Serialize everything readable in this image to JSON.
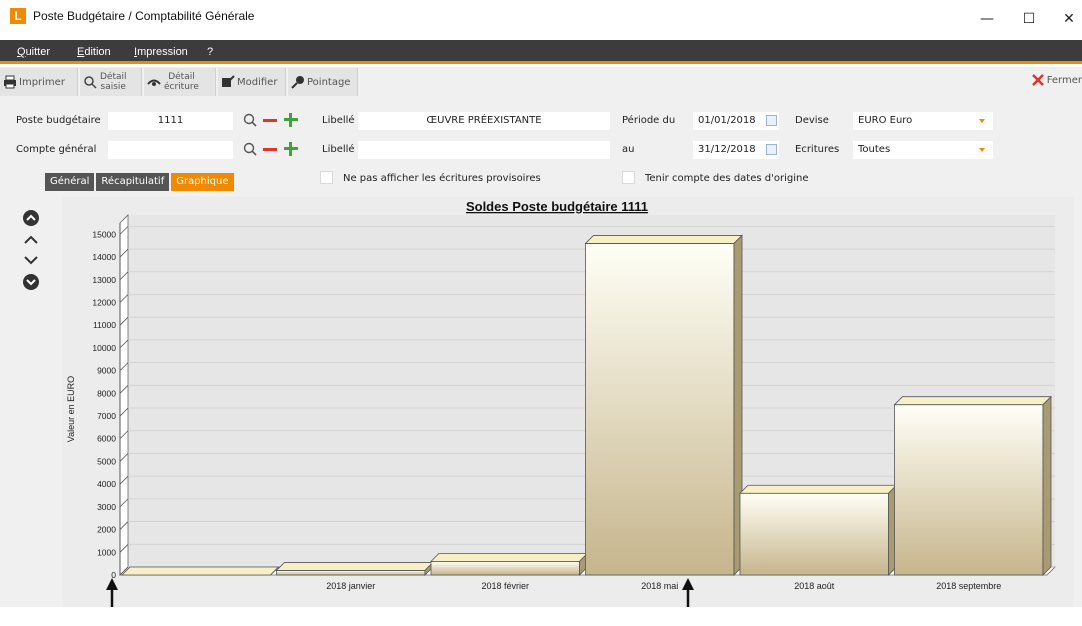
{
  "window": {
    "logo": "L",
    "title": "Poste Budgétaire / Comptabilité Générale",
    "minimize": "—",
    "maximize": "☐",
    "close": "✕"
  },
  "menu": [
    "Quitter",
    "Edition",
    "Impression",
    "?"
  ],
  "toolbar": {
    "imprimer": "Imprimer",
    "detail_saisie_1": "Détail",
    "detail_saisie_2": "saisie",
    "detail_ecriture_1": "Détail",
    "detail_ecriture_2": "écriture",
    "modifier": "Modifier",
    "pointage": "Pointage",
    "fermer": "Fermer"
  },
  "form": {
    "poste_label": "Poste budgétaire",
    "poste_value": "1111",
    "libelle1_label": "Libellé",
    "libelle1_value": "ŒUVRE PRÉEXISTANTE",
    "periode_label": "Période du",
    "date_from": "01/01/2018",
    "devise_label": "Devise",
    "devise_value": "EURO Euro",
    "compte_label": "Compte général",
    "compte_value": "",
    "libelle2_label": "Libellé",
    "libelle2_value": "",
    "au_label": "au",
    "date_to": "31/12/2018",
    "ecritures_label": "Ecritures",
    "ecritures_value": "Toutes",
    "chk1_label": "Ne pas afficher les écritures provisoires",
    "chk2_label": "Tenir compte des dates d'origine"
  },
  "tabs": [
    "Général",
    "Récapitulatif",
    "Graphique"
  ],
  "active_tab": "Graphique",
  "chart_data": {
    "type": "bar",
    "title": "Soldes Poste budgétaire 1111",
    "ylabel": "Valeur en EURO",
    "xlabel": "",
    "categories": [
      "",
      "2018 janvier",
      "2018 février",
      "2018 mai",
      "2018 août",
      "2018 septembre"
    ],
    "values": [
      0,
      200,
      600,
      14600,
      3600,
      7500
    ],
    "yticks": [
      0,
      1000,
      2000,
      3000,
      4000,
      5000,
      6000,
      7000,
      8000,
      9000,
      10000,
      11000,
      12000,
      13000,
      14000,
      15000
    ],
    "ylim": [
      0,
      15500
    ],
    "grid": true
  },
  "colors": {
    "accent": "#f08a00",
    "menubar": "#3c3c3c",
    "bar_face_top": "#fffff4",
    "bar_face_bottom": "#c8b88f",
    "bar_top": "#f7efc6",
    "bar_side": "#a89a72"
  }
}
